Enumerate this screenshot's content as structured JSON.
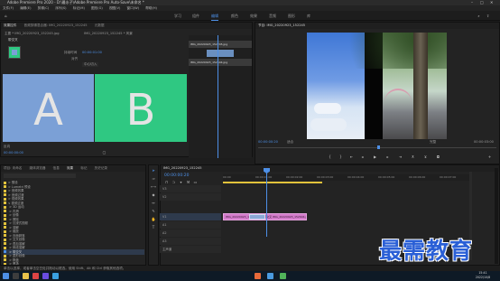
{
  "window": {
    "title": "Adobe Premiere Pro 2020 - D:\\最水子\\Adobe Premiere Pro Auto-Save\\未命名 *"
  },
  "menu": [
    "文件(F)",
    "编辑(E)",
    "剪辑(C)",
    "序列(S)",
    "标记(M)",
    "图形(G)",
    "视图(V)",
    "窗口(W)",
    "帮助(H)"
  ],
  "workspaces": [
    "学习",
    "组件",
    "编辑",
    "颜色",
    "效果",
    "音频",
    "图形",
    "库"
  ],
  "active_workspace": "编辑",
  "effect_controls": {
    "tabs": [
      "效果控件",
      "音频剪辑混合器: IMG_20220923_152245",
      "元数据"
    ],
    "active_tab": "效果控件",
    "source_label": "主要 * IMG_20220923_152245.jpg",
    "crumb": "IMG_20220923_152245 * 风景",
    "effect_name": "带交叉",
    "duration_label": "持续时间",
    "duration_value": "00:00:01:00",
    "align_label": "对齐",
    "align_value": "中心切入",
    "show_actual_label": "显示实际源",
    "tile_a_caption": "开始: 0.0",
    "tile_b_caption": "结束: 100.0",
    "tile_a_letter": "A",
    "tile_b_letter": "B",
    "reverse_label": "反向",
    "footer_time": "00:00:00:00",
    "mini_timeline_items": [
      "IMG_20220923_152245.jpg",
      "IMG_20220923_152604.jpg"
    ]
  },
  "program": {
    "title": "节目: IMG_20220923_152245",
    "timecode_left": "00:00:00:20",
    "fit": "适合",
    "quality": "完整",
    "timecode_right": "00:00:03:00"
  },
  "project": {
    "tabs": [
      "项目: 未命名",
      "媒体浏览器",
      "信息",
      "效果",
      "标记",
      "历史记录"
    ],
    "active_tab": "效果",
    "items": [
      {
        "label": "> 預设",
        "color": "#e1c23b"
      },
      {
        "label": "> Lumetri 预设",
        "color": "#e1c23b"
      },
      {
        "label": "> 音频效果",
        "color": "#e1c23b"
      },
      {
        "label": "> 音频过渡",
        "color": "#e1c23b"
      },
      {
        "label": "> 视频效果",
        "color": "#e1c23b"
      },
      {
        "label": "∨ 视频过渡",
        "color": "#e1c23b"
      },
      {
        "label": "  > 3D 运动",
        "color": "#e1c23b"
      },
      {
        "label": "  > 内滑",
        "color": "#e1c23b"
      },
      {
        "label": "  > 划像",
        "color": "#e1c23b"
      },
      {
        "label": "  > 擦除",
        "color": "#e1c23b"
      },
      {
        "label": "  > 沉浸式视频",
        "color": "#e1c23b"
      },
      {
        "label": "  > 溶解",
        "color": "#e1c23b"
      },
      {
        "label": "  > 缩放",
        "color": "#e1c23b"
      },
      {
        "label": "  > 页面剥落",
        "color": "#e1c23b"
      },
      {
        "label": "  > 交叉划像",
        "color": "#e1c23b"
      },
      {
        "label": "  > 叠加溶解",
        "color": "#e1c23b"
      },
      {
        "label": "  > 斜线溶解",
        "color": "#e1c23b"
      },
      {
        "label": "  > 带交叉",
        "color": "#4d8fe6"
      },
      {
        "label": "  > 菱形划像",
        "color": "#e1c23b"
      },
      {
        "label": "  > 棋盘",
        "color": "#e1c23b"
      },
      {
        "label": "  > 黑场",
        "color": "#e1c23b"
      }
    ]
  },
  "timeline": {
    "title": "IMG_20220923_152245",
    "timecode": "00:00:00:20",
    "ruler": [
      "00:00",
      "00:00:01:00",
      "00:00:02:00",
      "00:00:03:00",
      "00:00:04:00",
      "00:00:05:00",
      "00:00:06:00",
      "00:00:07:00",
      "00:00:08:00"
    ],
    "tracks": [
      {
        "label": "V3",
        "row": "v3"
      },
      {
        "label": "V2",
        "row": "v2"
      },
      {
        "label": "V1",
        "row": "v1"
      },
      {
        "label": "A1",
        "row": "a1"
      },
      {
        "label": "A2",
        "row": "a2"
      },
      {
        "label": "A3",
        "row": "a3"
      },
      {
        "label": "主声道",
        "row": "master"
      }
    ],
    "clip_label": "IMG_20220923_152245.jpg  带交叉  IMG_20220923_152604.jpg"
  },
  "status_bar": "单击以选择，或者单击空白处并拖动以框选。使用 Shift、Alt 和 Ctrl 获取其他选项。",
  "watermark": "最需教育",
  "taskbar": {
    "time": "15:41",
    "date": "2022/10/8"
  }
}
